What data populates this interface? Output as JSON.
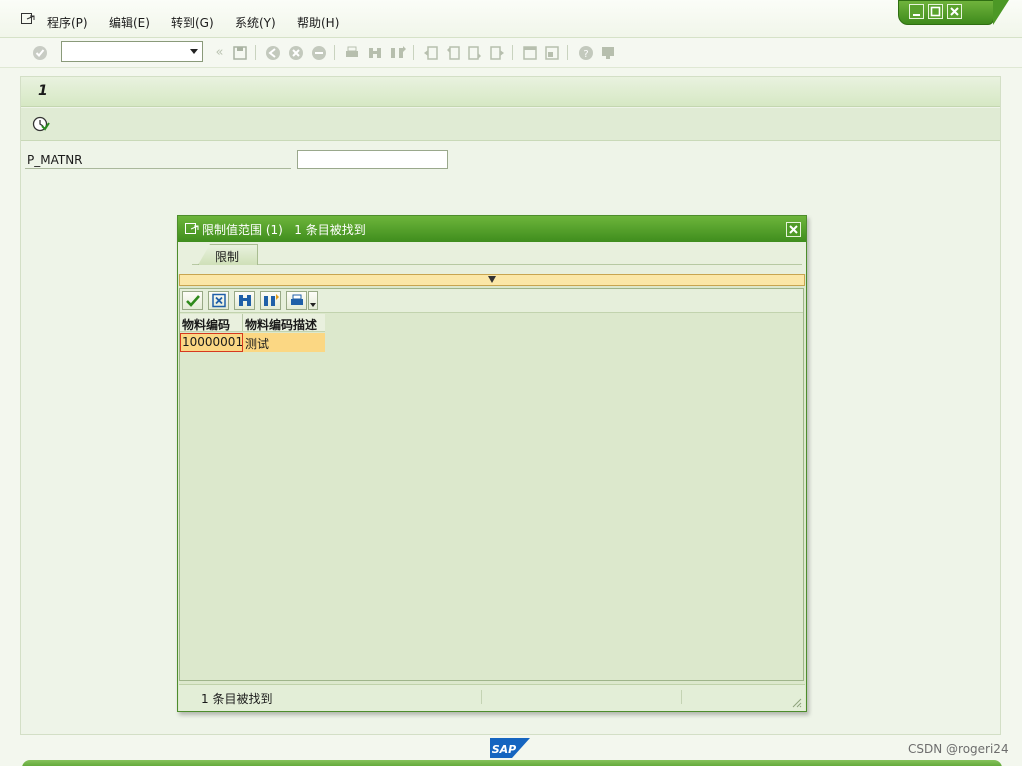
{
  "menubar": {
    "items": [
      {
        "label": "程序(P)"
      },
      {
        "label": "编辑(E)"
      },
      {
        "label": "转到(G)"
      },
      {
        "label": "系统(Y)"
      },
      {
        "label": "帮助(H)"
      }
    ]
  },
  "toolbar": {
    "command_field": {
      "value": "",
      "placeholder": ""
    },
    "icons": [
      "enter-icon",
      "back-icon",
      "save-icon",
      "back-nav-icon",
      "exit-icon",
      "cancel-icon",
      "print-icon",
      "find-icon",
      "find-next-icon",
      "first-page-icon",
      "previous-page-icon",
      "next-page-icon",
      "last-page-icon",
      "new-session-icon",
      "shortcut-icon",
      "help-icon",
      "customize-layout-icon"
    ]
  },
  "screen": {
    "title": "1",
    "parameter": {
      "label": "P_MATNR",
      "value": ""
    }
  },
  "dialog": {
    "title": "限制值范围 (1)   1 条目被找到",
    "tab_label": "限制",
    "columns": [
      "物料编码",
      "物料编码描述"
    ],
    "rows": [
      {
        "code": "10000001",
        "desc": "测试"
      }
    ],
    "status_text": "1 条目被找到"
  },
  "footer": {
    "logo_text": "SAP",
    "watermark": "CSDN @rogeri24"
  },
  "colors": {
    "accent_green": "#4f9a27",
    "selection_yellow": "#fbd783",
    "background": "#eef4e8"
  }
}
